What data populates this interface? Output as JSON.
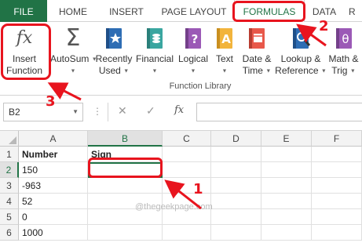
{
  "tabs": {
    "file": "FILE",
    "home": "HOME",
    "insert": "INSERT",
    "page_layout": "PAGE LAYOUT",
    "formulas": "FORMULAS",
    "data": "DATA",
    "more": "R"
  },
  "ribbon": {
    "insert_function": {
      "icon": "fx",
      "line1": "Insert",
      "line2": "Function"
    },
    "autosum": {
      "icon": "Σ",
      "line1": "AutoSum",
      "line2": ""
    },
    "recently_used": {
      "line1": "Recently",
      "line2": "Used"
    },
    "financial": {
      "line1": "Financial"
    },
    "logical": {
      "line1": "Logical"
    },
    "text": {
      "line1": "Text"
    },
    "date_time": {
      "line1": "Date &",
      "line2": "Time"
    },
    "lookup_reference": {
      "line1": "Lookup &",
      "line2": "Reference"
    },
    "math_trig": {
      "line1": "Math &",
      "line2": "Trig"
    },
    "group_label": "Function Library"
  },
  "formula_bar": {
    "name_box": "B2",
    "cancel": "✕",
    "enter": "✓",
    "fx": "fx",
    "value": ""
  },
  "sheet": {
    "columns": [
      "A",
      "B",
      "C",
      "D",
      "E",
      "F"
    ],
    "selected_column": "B",
    "rows": [
      {
        "num": "1",
        "a": "Number",
        "b": "Sign"
      },
      {
        "num": "2",
        "a": "150",
        "b": ""
      },
      {
        "num": "3",
        "a": "-963",
        "b": ""
      },
      {
        "num": "4",
        "a": "52",
        "b": ""
      },
      {
        "num": "5",
        "a": "0",
        "b": ""
      },
      {
        "num": "6",
        "a": "1000",
        "b": ""
      }
    ],
    "active_cell": "B2",
    "watermark": "@thegeekpage.com"
  },
  "annotations": {
    "step1": "1",
    "step2": "2",
    "step3": "3",
    "color": "#e8141e"
  },
  "colors": {
    "accent": "#217346"
  }
}
